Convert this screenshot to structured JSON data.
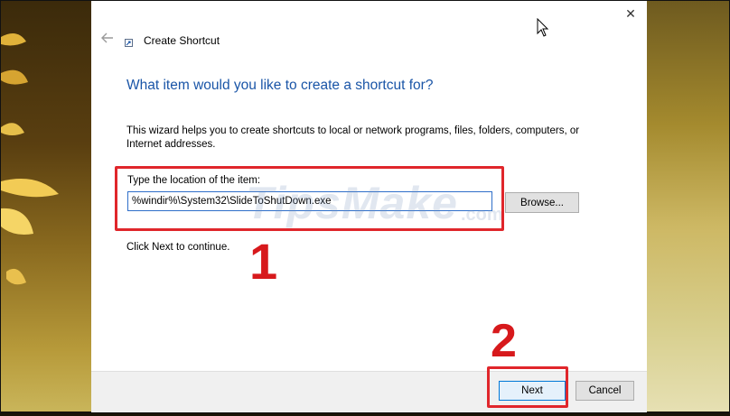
{
  "window": {
    "title": "Create Shortcut",
    "back_icon": "back-arrow-icon",
    "close_glyph": "✕"
  },
  "main": {
    "heading": "What item would you like to create a shortcut for?",
    "description": "This wizard helps you to create shortcuts to local or network programs, files, folders, computers, or Internet addresses.",
    "location_label": "Type the location of the item:",
    "location_value": "%windir%\\System32\\SlideToShutDown.exe",
    "browse_label": "Browse...",
    "continue_text": "Click Next to continue."
  },
  "footer": {
    "next_label": "Next",
    "cancel_label": "Cancel"
  },
  "annotations": {
    "step1": "1",
    "step2": "2",
    "highlight_color": "#e0262b"
  },
  "watermark": {
    "text": "TipsMake",
    "sub": ".com"
  },
  "colors": {
    "heading": "#1a55a7",
    "input_border": "#2f6fc9",
    "default_button_border": "#0078d7"
  }
}
